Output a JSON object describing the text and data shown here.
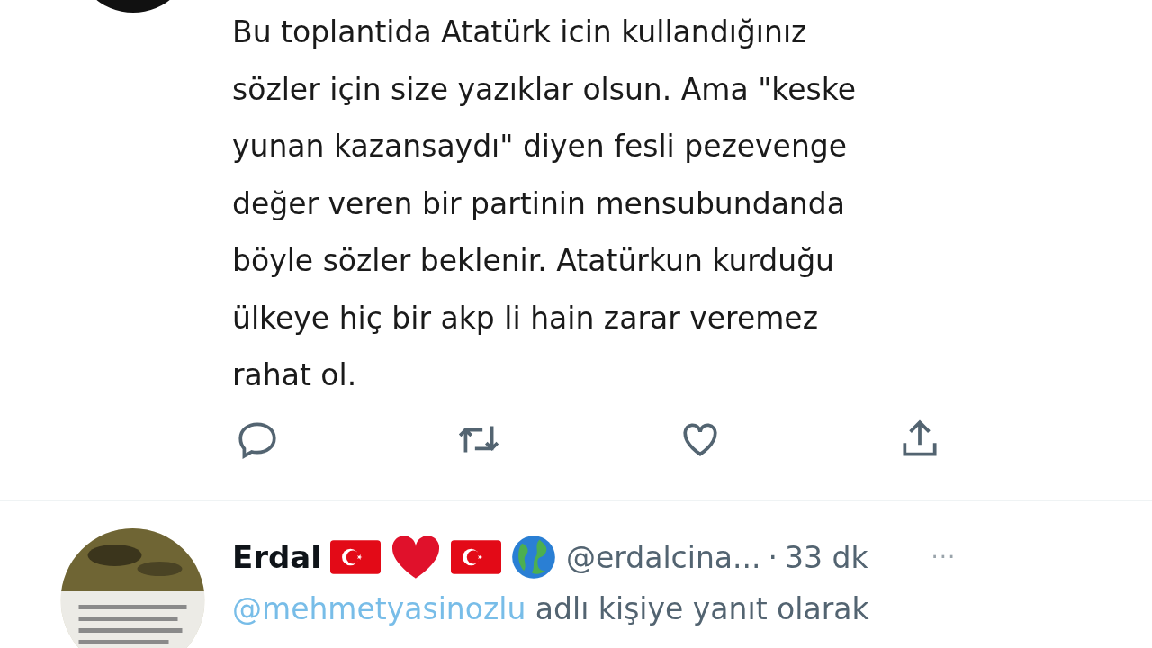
{
  "tweet": {
    "text_lines": [
      "Bu toplantida Atatürk icin kullandığınız",
      "sözler için size yazıklar olsun. Ama \"keske",
      "yunan kazansaydı\" diyen fesli pezevenge",
      "değer veren bir partinin mensubundanda",
      "böyle sözler beklenir. Atatürkun kurduğu",
      "ülkeye hiç bir akp li hain zarar veremez",
      "rahat ol."
    ]
  },
  "reply": {
    "name": "Erdal",
    "handle": "@erdalcina...",
    "separator": "·",
    "time": "33 dk",
    "more": "···",
    "reply_to": "@mehmetyasinozlu",
    "reply_suffix": "adlı kişiye yanıt olarak"
  }
}
